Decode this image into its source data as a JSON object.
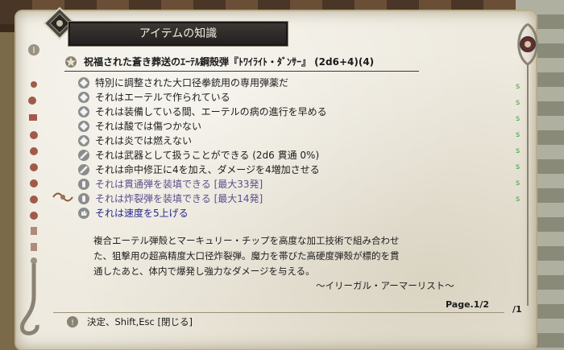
{
  "window": {
    "title": "アイテムの知識"
  },
  "item": {
    "name": "祝福された蒼き葬送のｴｰﾃﾙ鋼殻弾『ﾄﾜｲﾗｲﾄ・ﾀﾞﾝｻｰ』 (2d6+4)(4)"
  },
  "properties": [
    {
      "text": "特別に調整された大口径拳銃用の専用弾薬だ",
      "icon": "diamond-icon",
      "style": "normal"
    },
    {
      "text": "それはエーテルで作られている",
      "icon": "diamond-icon",
      "style": "normal"
    },
    {
      "text": "それは装備している間、エーテルの病の進行を早める",
      "icon": "diamond-icon",
      "style": "normal"
    },
    {
      "text": "それは酸では傷つかない",
      "icon": "diamond-icon",
      "style": "normal"
    },
    {
      "text": "それは炎では燃えない",
      "icon": "diamond-icon",
      "style": "normal"
    },
    {
      "text": "それは武器として扱うことができる (2d6 貫通 0%)",
      "icon": "sword-icon",
      "style": "normal"
    },
    {
      "text": "それは命中修正に4を加え、ダメージを4増加させる",
      "icon": "sword-icon",
      "style": "normal"
    },
    {
      "text": "それは貫通弾を装填できる [最大33発]",
      "icon": "bullet-icon",
      "style": "special"
    },
    {
      "text": "それは炸裂弾を装填できる [最大14発]",
      "icon": "bullet-icon",
      "style": "special"
    },
    {
      "text": "それは速度を5上げる",
      "icon": "hand-icon",
      "style": "enchant"
    }
  ],
  "description": {
    "lines": [
      "複合エーテル弾殻とマーキュリー・チップを高度な加工技術で組み合わせ",
      "た、狙撃用の超高精度大口径炸裂弾。魔力を帯びた高硬度弾殻が標的を貫",
      "通したあと、体内で爆発し強力なダメージを与える。"
    ],
    "signature": "～イリーガル・アーマーリスト～"
  },
  "page": {
    "label": "Page.1/2",
    "alt": "/1"
  },
  "footer": {
    "hint": "決定、Shift,Esc [閉じる]"
  },
  "colors": {
    "parchment": "#eeeadf",
    "title_bg": "#2a2724",
    "special_text": "#5a4f8e",
    "enchant_text": "#26278f"
  }
}
